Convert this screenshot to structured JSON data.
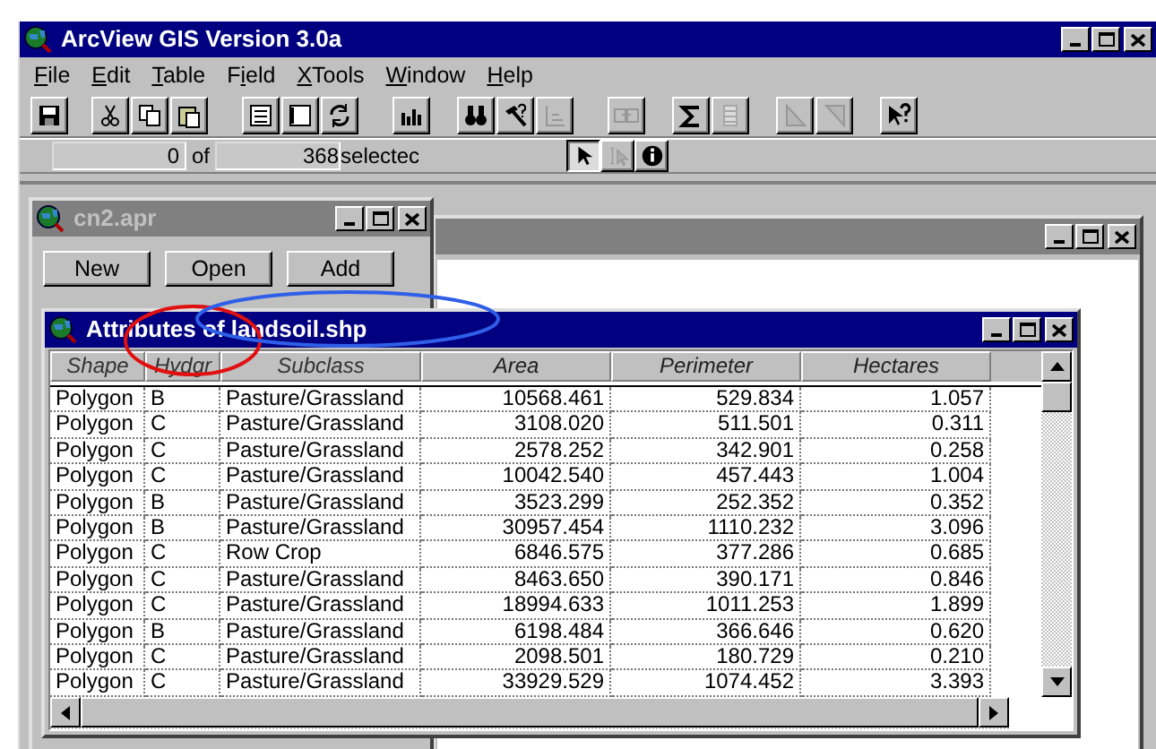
{
  "window": {
    "title": "ArcView GIS Version 3.0a",
    "active": true
  },
  "menu": [
    {
      "key": "F",
      "rest": "ile"
    },
    {
      "key": "E",
      "rest": "dit"
    },
    {
      "key": "T",
      "rest": "able"
    },
    {
      "before": "F",
      "key": "i",
      "rest": "eld"
    },
    {
      "key": "X",
      "rest": "Tools"
    },
    {
      "key": "W",
      "rest": "indow"
    },
    {
      "key": "H",
      "rest": "elp"
    }
  ],
  "toolbar": [
    {
      "kind": "save",
      "disabled": false
    },
    {
      "kind": "cut",
      "disabled": false
    },
    {
      "kind": "copy",
      "disabled": false
    },
    {
      "kind": "paste",
      "disabled": false
    },
    {
      "kind": "list",
      "disabled": false
    },
    {
      "kind": "window",
      "disabled": false
    },
    {
      "kind": "refresh",
      "disabled": false
    },
    {
      "kind": "chart",
      "disabled": false
    },
    {
      "kind": "binoculars",
      "disabled": false
    },
    {
      "kind": "hammer",
      "disabled": false
    },
    {
      "kind": "axis",
      "disabled": true
    },
    {
      "kind": "join",
      "disabled": true
    },
    {
      "kind": "sigma",
      "disabled": false
    },
    {
      "kind": "column",
      "disabled": true
    },
    {
      "kind": "sort-up",
      "disabled": true
    },
    {
      "kind": "sort-down",
      "disabled": true
    },
    {
      "kind": "help",
      "disabled": false
    }
  ],
  "status": {
    "selected": "0",
    "of": "of",
    "total": "368",
    "suffix": "selectec"
  },
  "tools": [
    {
      "kind": "pointer",
      "selected": true,
      "disabled": false
    },
    {
      "kind": "text-pointer",
      "selected": false,
      "disabled": true
    },
    {
      "kind": "info",
      "selected": false,
      "disabled": false
    }
  ],
  "project_window": {
    "title": "cn2.apr",
    "active": false,
    "buttons": [
      "New",
      "Open",
      "Add"
    ]
  },
  "background_window": {
    "active": false
  },
  "attributes_window": {
    "title": "Attributes of landsoil.shp",
    "active": true,
    "columns": [
      {
        "label": "Shape",
        "numeric": false
      },
      {
        "label": "Hydgr",
        "numeric": false
      },
      {
        "label": "Subclass",
        "numeric": false
      },
      {
        "label": "Area",
        "numeric": true
      },
      {
        "label": "Perimeter",
        "numeric": true
      },
      {
        "label": "Hectares",
        "numeric": true
      }
    ],
    "rows": [
      [
        "Polygon",
        "B",
        "Pasture/Grassland",
        "10568.461",
        "529.834",
        "1.057"
      ],
      [
        "Polygon",
        "C",
        "Pasture/Grassland",
        "3108.020",
        "511.501",
        "0.311"
      ],
      [
        "Polygon",
        "C",
        "Pasture/Grassland",
        "2578.252",
        "342.901",
        "0.258"
      ],
      [
        "Polygon",
        "C",
        "Pasture/Grassland",
        "10042.540",
        "457.443",
        "1.004"
      ],
      [
        "Polygon",
        "B",
        "Pasture/Grassland",
        "3523.299",
        "252.352",
        "0.352"
      ],
      [
        "Polygon",
        "B",
        "Pasture/Grassland",
        "30957.454",
        "1110.232",
        "3.096"
      ],
      [
        "Polygon",
        "C",
        "Row Crop",
        "6846.575",
        "377.286",
        "0.685"
      ],
      [
        "Polygon",
        "C",
        "Pasture/Grassland",
        "8463.650",
        "390.171",
        "0.846"
      ],
      [
        "Polygon",
        "C",
        "Pasture/Grassland",
        "18994.633",
        "1011.253",
        "1.899"
      ],
      [
        "Polygon",
        "B",
        "Pasture/Grassland",
        "6198.484",
        "366.646",
        "0.620"
      ],
      [
        "Polygon",
        "C",
        "Pasture/Grassland",
        "2098.501",
        "180.729",
        "0.210"
      ],
      [
        "Polygon",
        "C",
        "Pasture/Grassland",
        "33929.529",
        "1074.452",
        "3.393"
      ]
    ]
  },
  "annotations": [
    {
      "kind": "ellipse",
      "color": "#e01010"
    },
    {
      "kind": "ellipse",
      "color": "#2f5fe8"
    }
  ]
}
